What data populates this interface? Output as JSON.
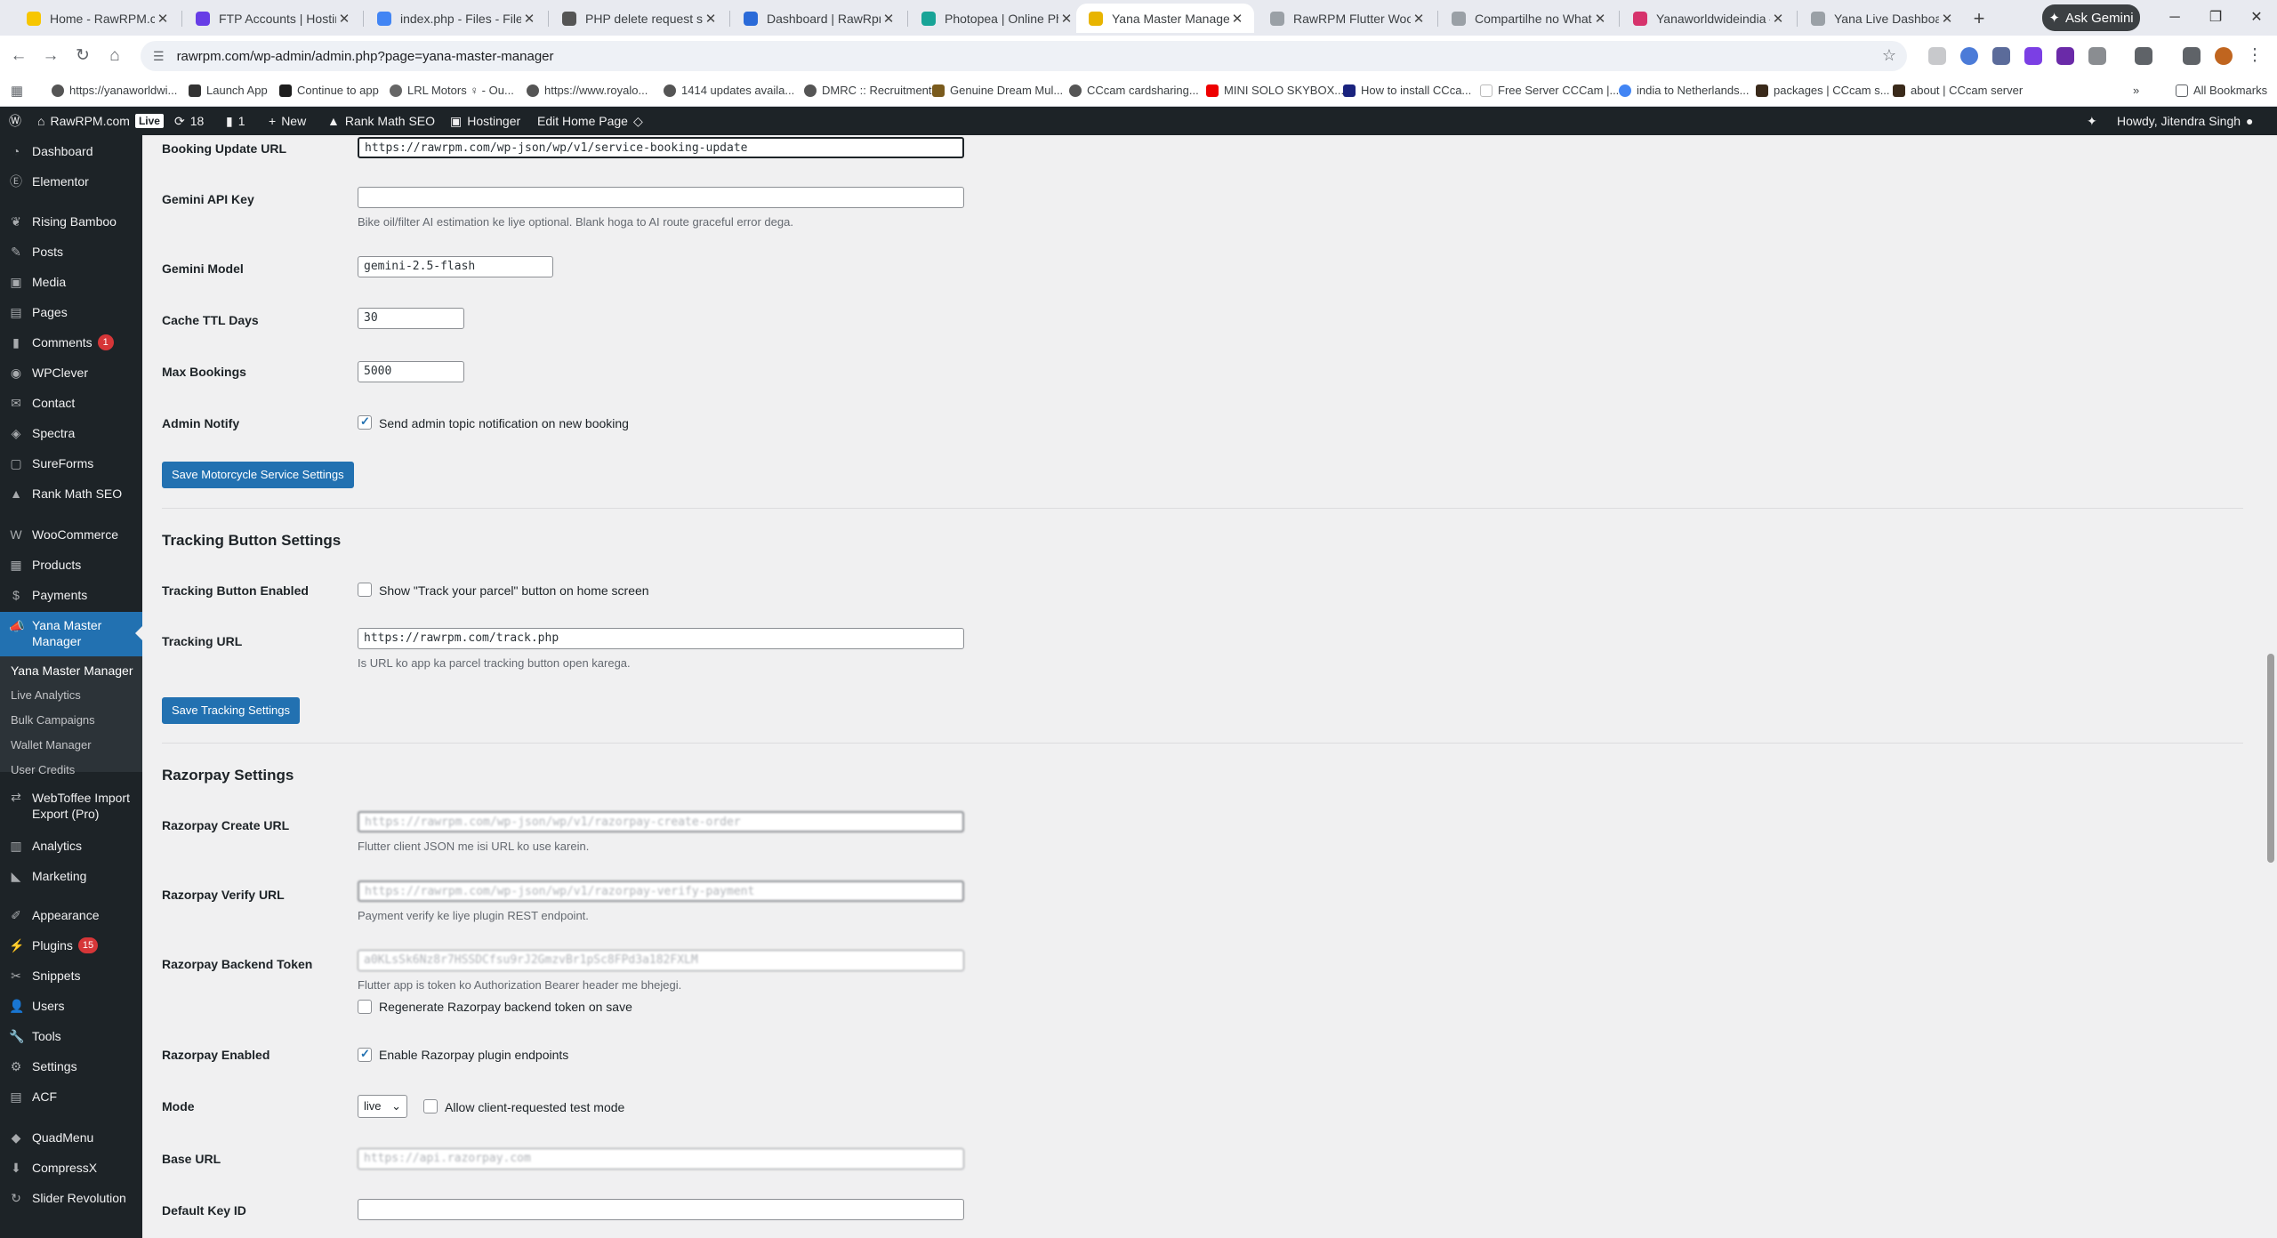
{
  "tabs": [
    {
      "title": "Home - RawRPM.com",
      "color": "#f7c600"
    },
    {
      "title": "FTP Accounts | Hosting",
      "color": "#673de6"
    },
    {
      "title": "index.php - Files - File B",
      "color": "#4285f4"
    },
    {
      "title": "PHP delete request syste",
      "color": "#555555"
    },
    {
      "title": "Dashboard | RawRpm",
      "color": "#2a6ad8"
    },
    {
      "title": "Photopea | Online Photo",
      "color": "#18a497"
    },
    {
      "title": "Yana Master Manager ‹ ",
      "color": "#e8b400"
    },
    {
      "title": "RawRPM Flutter WooCo",
      "color": "#9aa0a6"
    },
    {
      "title": "Compartilhe no WhatsA",
      "color": "#9aa0a6"
    },
    {
      "title": "Yanaworldwideindia – A",
      "color": "#d6336c"
    },
    {
      "title": "Yana Live Dashboard",
      "color": "#9aa0a6"
    }
  ],
  "ask_gemini": "Ask Gemini",
  "url": "rawrpm.com/wp-admin/admin.php?page=yana-master-manager",
  "bookmarks": [
    "https://yanaworldwi...",
    "Launch App",
    "Continue to app",
    "LRL Motors ♀ - Ou...",
    "https://www.royalo...",
    "1414 updates availa...",
    "DMRC :: Recruitment",
    "Genuine Dream Mul...",
    "CCcam cardsharing...",
    "MINI SOLO SKYBOX...",
    "How to install CCca...",
    "Free Server CCCam |...",
    "india to Netherlands...",
    "packages | CCcam s...",
    "about | CCcam server"
  ],
  "all_bookmarks": "All Bookmarks",
  "adminbar": {
    "site": "RawRPM.com",
    "live": "Live",
    "updates": "18",
    "comments": "1",
    "new": "New",
    "rankmath": "Rank Math SEO",
    "hostinger": "Hostinger",
    "edit": "Edit Home Page",
    "howdy": "Howdy, Jitendra Singh"
  },
  "sidebar": {
    "items": [
      {
        "label": "Dashboard",
        "icon": "dashboard-icon"
      },
      {
        "label": "Elementor",
        "icon": "elementor-icon"
      },
      {
        "label": "Rising Bamboo",
        "icon": "bamboo-icon"
      },
      {
        "label": "Posts",
        "icon": "pin-icon"
      },
      {
        "label": "Media",
        "icon": "media-icon"
      },
      {
        "label": "Pages",
        "icon": "pages-icon"
      },
      {
        "label": "Comments",
        "icon": "comments-icon",
        "badge": "1"
      },
      {
        "label": "WPClever",
        "icon": "wpclever-icon"
      },
      {
        "label": "Contact",
        "icon": "mail-icon"
      },
      {
        "label": "Spectra",
        "icon": "spectra-icon"
      },
      {
        "label": "SureForms",
        "icon": "sureforms-icon"
      },
      {
        "label": "Rank Math SEO",
        "icon": "rankmath-icon"
      },
      {
        "label": "WooCommerce",
        "icon": "woo-icon"
      },
      {
        "label": "Products",
        "icon": "products-icon"
      },
      {
        "label": "Payments",
        "icon": "payments-icon"
      },
      {
        "label": "Yana Master Manager",
        "icon": "megaphone-icon"
      },
      {
        "label": "WebToffee Import Export (Pro)",
        "icon": "import-export-icon"
      },
      {
        "label": "Analytics",
        "icon": "analytics-icon"
      },
      {
        "label": "Marketing",
        "icon": "marketing-icon"
      },
      {
        "label": "Appearance",
        "icon": "appearance-icon"
      },
      {
        "label": "Plugins",
        "icon": "plugins-icon",
        "badge": "15"
      },
      {
        "label": "Snippets",
        "icon": "snippets-icon"
      },
      {
        "label": "Users",
        "icon": "users-icon"
      },
      {
        "label": "Tools",
        "icon": "tools-icon"
      },
      {
        "label": "Settings",
        "icon": "settings-icon"
      },
      {
        "label": "ACF",
        "icon": "acf-icon"
      },
      {
        "label": "QuadMenu",
        "icon": "quadmenu-icon"
      },
      {
        "label": "CompressX",
        "icon": "compress-icon"
      },
      {
        "label": "Slider Revolution",
        "icon": "slider-icon"
      }
    ],
    "submenu": [
      "Yana Master Manager",
      "Live Analytics",
      "Bulk Campaigns",
      "Wallet Manager",
      "User Credits"
    ]
  },
  "form": {
    "booking_update_label": "Booking Update URL",
    "booking_update_value": "https://rawrpm.com/wp-json/wp/v1/service-booking-update",
    "gemini_key_label": "Gemini API Key",
    "gemini_key_value": "",
    "gemini_key_desc": "Bike oil/filter AI estimation ke liye optional. Blank hoga to AI route graceful error dega.",
    "gemini_model_label": "Gemini Model",
    "gemini_model_value": "gemini-2.5-flash",
    "cache_ttl_label": "Cache TTL Days",
    "cache_ttl_value": "30",
    "max_bookings_label": "Max Bookings",
    "max_bookings_value": "5000",
    "admin_notify_label": "Admin Notify",
    "admin_notify_text": "Send admin topic notification on new booking",
    "save_moto": "Save Motorcycle Service Settings",
    "tracking_title": "Tracking Button Settings",
    "tracking_enabled_label": "Tracking Button Enabled",
    "tracking_enabled_text": "Show \"Track your parcel\" button on home screen",
    "tracking_url_label": "Tracking URL",
    "tracking_url_value": "https://rawrpm.com/track.php",
    "tracking_url_desc": "Is URL ko app ka parcel tracking button open karega.",
    "save_tracking": "Save Tracking Settings",
    "razorpay_title": "Razorpay Settings",
    "rp_create_label": "Razorpay Create URL",
    "rp_create_value": "https://rawrpm.com/wp-json/wp/v1/razorpay-create-order",
    "rp_create_desc": "Flutter client JSON me isi URL ko use karein.",
    "rp_verify_label": "Razorpay Verify URL",
    "rp_verify_value": "https://rawrpm.com/wp-json/wp/v1/razorpay-verify-payment",
    "rp_verify_desc": "Payment verify ke liye plugin REST endpoint.",
    "rp_token_label": "Razorpay Backend Token",
    "rp_token_value": "a0KLsSk6Nz8r7HSSDCfsu9rJ2GmzvBr1pSc8FPd3a182FXLM",
    "rp_token_desc": "Flutter app is token ko Authorization Bearer header me bhejegi.",
    "rp_regen_text": "Regenerate Razorpay backend token on save",
    "rp_enabled_label": "Razorpay Enabled",
    "rp_enabled_text": "Enable Razorpay plugin endpoints",
    "mode_label": "Mode",
    "mode_value": "live",
    "mode_test_text": "Allow client-requested test mode",
    "base_url_label": "Base URL",
    "base_url_value": "https://api.razorpay.com",
    "default_key_label": "Default Key ID",
    "default_key_value": ""
  }
}
